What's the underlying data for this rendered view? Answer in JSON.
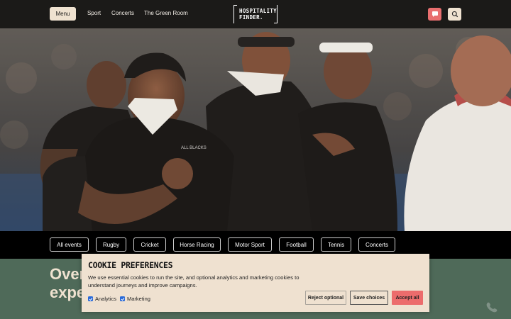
{
  "header": {
    "menu_label": "Menu",
    "nav": [
      "Sport",
      "Concerts",
      "The Green Room"
    ],
    "logo_line1": "HOSPITALITY",
    "logo_line2": "FINDER.",
    "chat_icon": "chat-icon",
    "search_icon": "search-icon",
    "colors": {
      "background": "#1b1a18",
      "menu_button": "#efe2d0",
      "chat_button": "#e96f6f"
    }
  },
  "hero": {
    "image": "rugby-players-haka-photo",
    "jersey_text": "ALL BLACKS"
  },
  "categories": [
    "All events",
    "Rugby",
    "Cricket",
    "Horse Racing",
    "Motor Sport",
    "Football",
    "Tennis",
    "Concerts"
  ],
  "section": {
    "heading": "Over\nexpe",
    "background": "#4f6a59"
  },
  "cookie": {
    "title": "COOKIE PREFERENCES",
    "text": "We use essential cookies to run the site, and optional analytics and marketing cookies to understand journeys and improve campaigns.",
    "options": [
      {
        "label": "Analytics",
        "checked": true
      },
      {
        "label": "Marketing",
        "checked": true
      }
    ],
    "reject_label": "Reject optional",
    "choices_label": "Save choices",
    "accept_label": "Accept all",
    "colors": {
      "background": "#efe1d0",
      "accept": "#ec6c6c"
    }
  }
}
